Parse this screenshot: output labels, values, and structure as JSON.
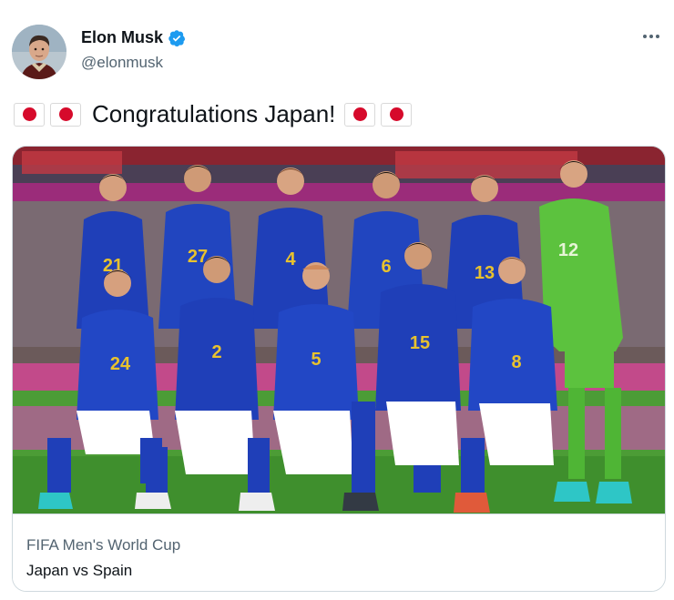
{
  "author": {
    "display_name": "Elon Musk",
    "handle": "@elonmusk",
    "verified": true,
    "avatar_icon": "profile-photo"
  },
  "tweet": {
    "text": "Congratulations Japan!",
    "leading_emojis": [
      "japan-flag",
      "japan-flag"
    ],
    "trailing_emojis": [
      "japan-flag",
      "japan-flag"
    ]
  },
  "card": {
    "source": "FIFA Men's World Cup",
    "title": "Japan vs Spain",
    "image_description": "Japan national football team lineup photo",
    "players_back_row": [
      "21",
      "27",
      "4",
      "6",
      "13",
      "12"
    ],
    "players_front_row": [
      "24",
      "2",
      "5",
      "15",
      "8"
    ]
  },
  "colors": {
    "text_primary": "#0f1419",
    "text_secondary": "#536471",
    "border": "#cfd9de",
    "verified_blue": "#1d9bf0",
    "japan_red": "#d60a2b",
    "kit_blue": "#1f3fb8",
    "keeper_green": "#5cc23e"
  },
  "menu": {
    "icon": "more-horizontal-icon"
  }
}
